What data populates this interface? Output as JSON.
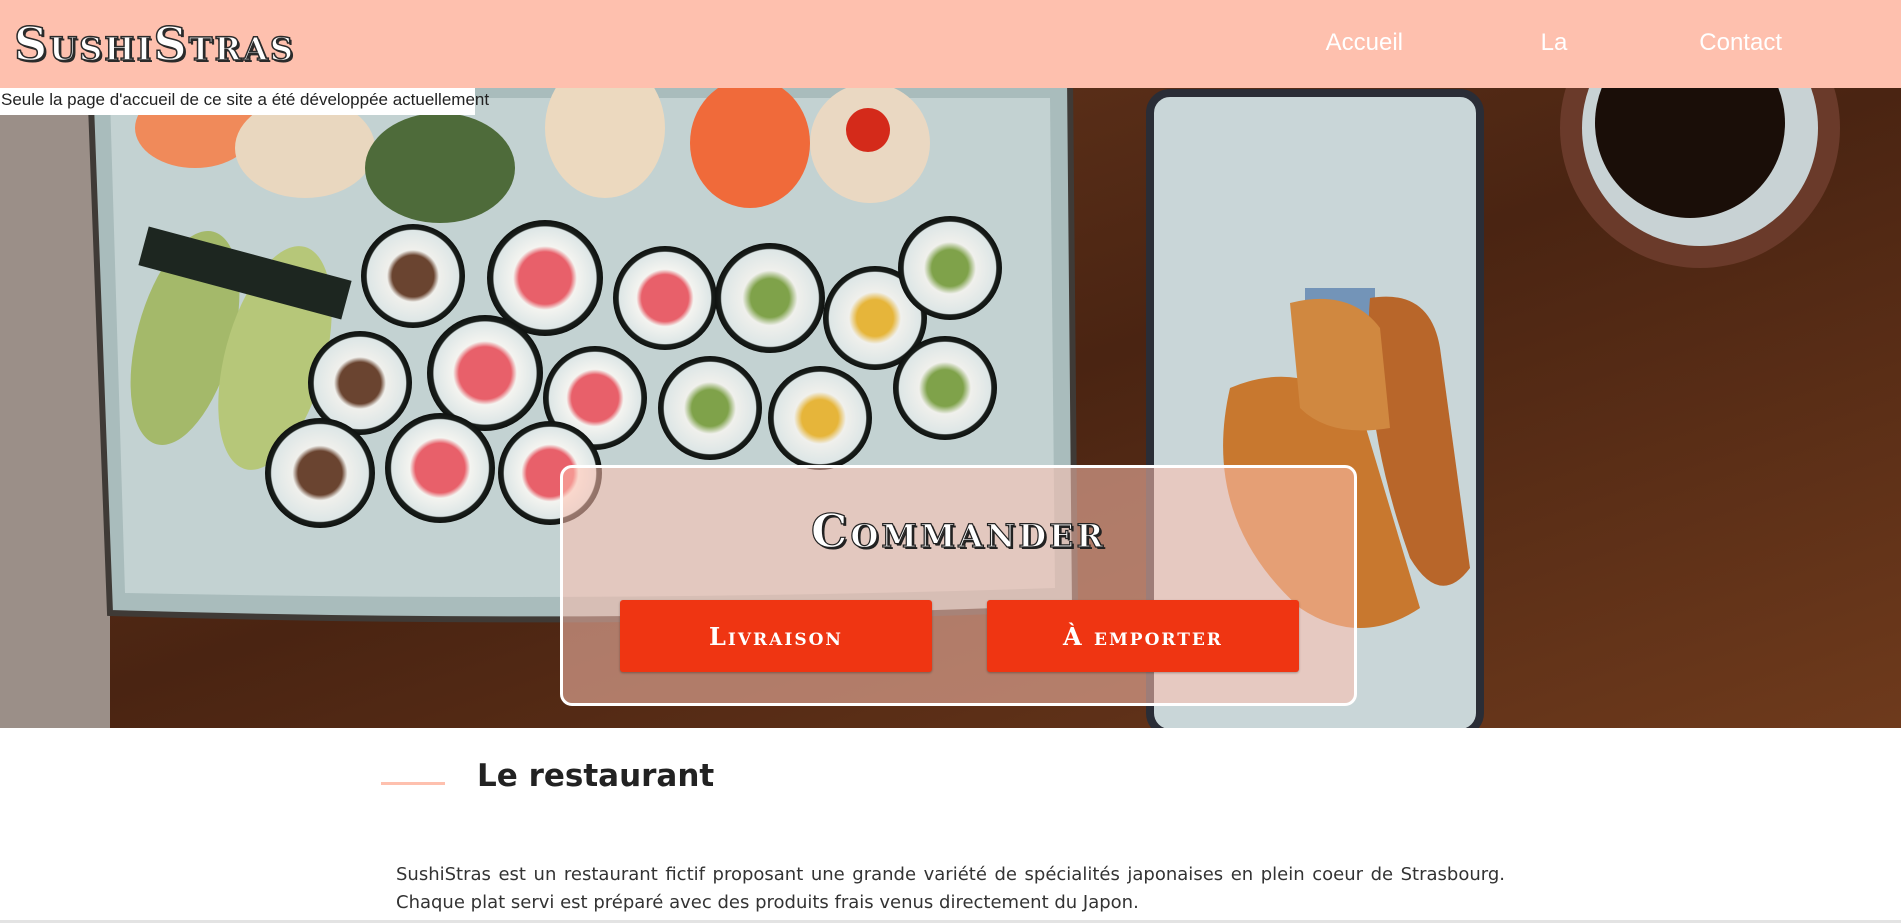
{
  "header": {
    "logo": "SushiStras",
    "nav": [
      "Accueil",
      "La carte",
      "Contact"
    ]
  },
  "notice": "Seule la page d'accueil de ce site a été développée actuellement",
  "hero": {
    "order_title": "Commander",
    "buttons": {
      "delivery": "Livraison",
      "takeaway": "À emporter"
    }
  },
  "restaurant": {
    "title": "Le restaurant",
    "description": "SushiStras est un restaurant fictif proposant une grande variété de spécialités japonaises en plein coeur de Strasbourg. Chaque plat servi est préparé avec des produits frais venus directement du Japon."
  },
  "colors": {
    "header_bg": "#fec0ae",
    "button_bg": "#ef3512",
    "accent_line": "#fec0ae"
  }
}
